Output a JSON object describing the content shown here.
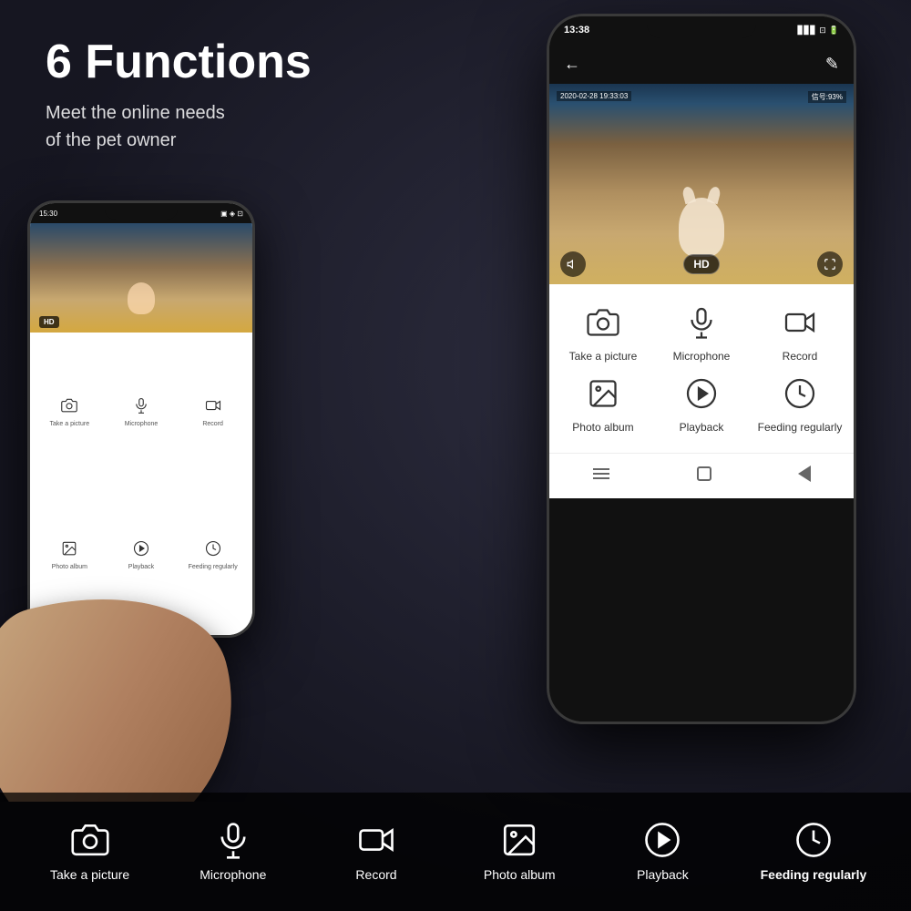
{
  "background": {
    "color_top": "#2a2a3e",
    "color_bottom": "#111120"
  },
  "headline": {
    "title": "6 Functions",
    "subtitle_line1": "Meet the online needs",
    "subtitle_line2": "of the pet owner"
  },
  "phone_large": {
    "status_time": "13:38",
    "status_signal": "信号:93%",
    "cam_timestamp": "2020-02-28 19:33:03",
    "cam_signal_label": "信号:93%",
    "hd_label": "HD",
    "functions": [
      {
        "id": "take_a_picture",
        "label": "Take a picture",
        "icon": "camera"
      },
      {
        "id": "microphone",
        "label": "Microphone",
        "icon": "mic"
      },
      {
        "id": "record",
        "label": "Record",
        "icon": "record"
      },
      {
        "id": "photo_album",
        "label": "Photo album",
        "icon": "photo"
      },
      {
        "id": "playback",
        "label": "Playback",
        "icon": "playback"
      },
      {
        "id": "feeding_regularly",
        "label": "Feeding regularly",
        "icon": "clock"
      }
    ]
  },
  "bottom_bar": {
    "items": [
      {
        "id": "take_a_picture",
        "label": "Take a picture",
        "icon": "camera",
        "bold": false
      },
      {
        "id": "microphone",
        "label": "Microphone",
        "icon": "mic",
        "bold": false
      },
      {
        "id": "record",
        "label": "Record",
        "icon": "record",
        "bold": false
      },
      {
        "id": "photo_album",
        "label": "Photo album",
        "icon": "photo",
        "bold": false
      },
      {
        "id": "playback",
        "label": "Playback",
        "icon": "playback",
        "bold": false
      },
      {
        "id": "feeding_regularly",
        "label": "Feeding regularly",
        "icon": "clock",
        "bold": true
      }
    ]
  }
}
